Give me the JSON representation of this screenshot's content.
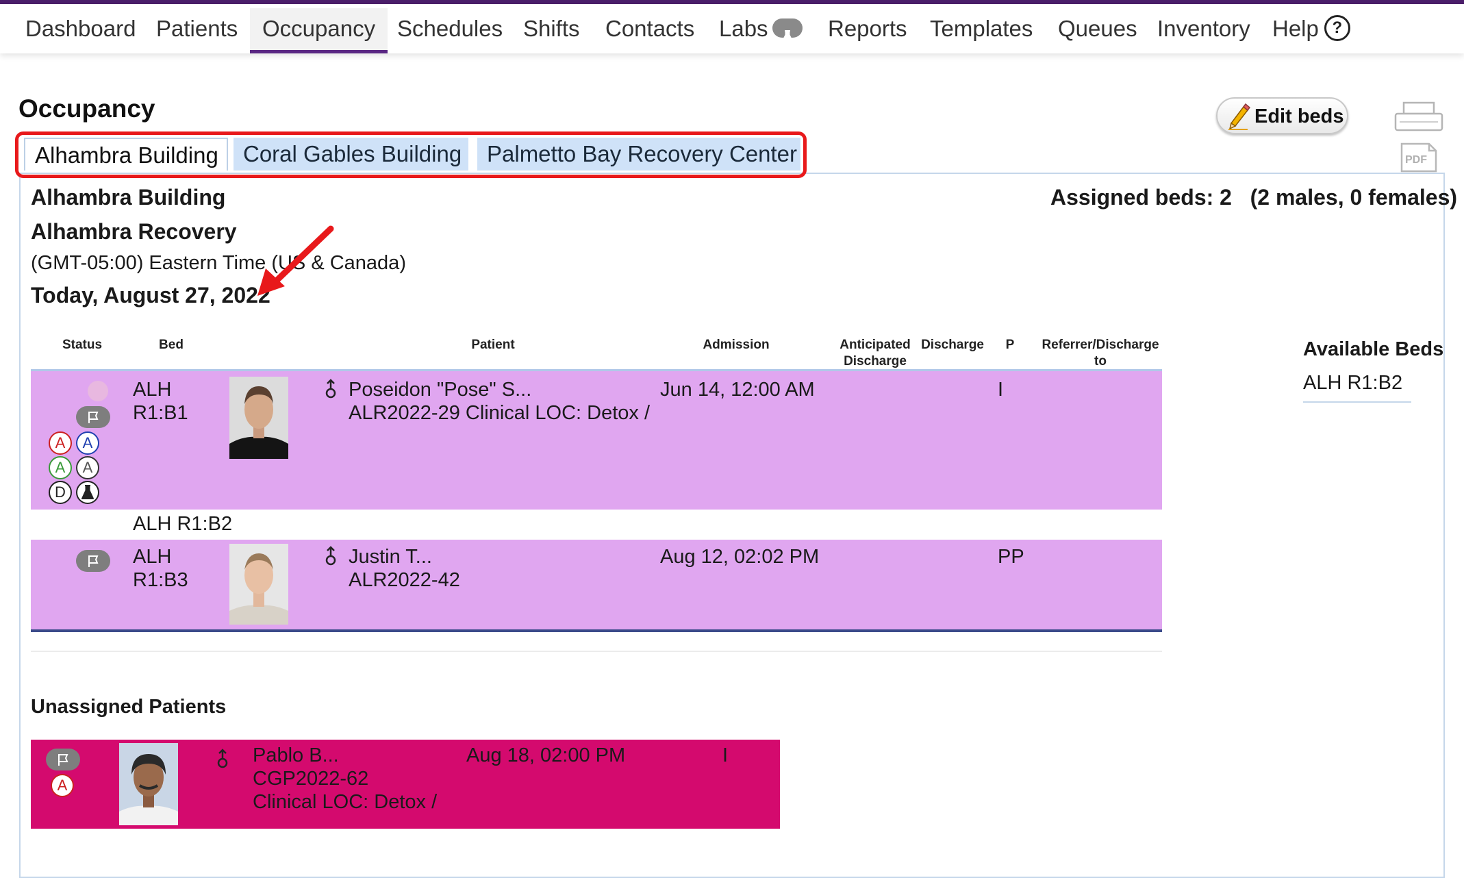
{
  "nav": {
    "items": [
      {
        "label": "Dashboard"
      },
      {
        "label": "Patients"
      },
      {
        "label": "Occupancy"
      },
      {
        "label": "Schedules"
      },
      {
        "label": "Shifts"
      },
      {
        "label": "Contacts"
      },
      {
        "label": "Labs"
      },
      {
        "label": "Reports"
      },
      {
        "label": "Templates"
      },
      {
        "label": "Queues"
      },
      {
        "label": "Inventory"
      },
      {
        "label": "Help"
      }
    ],
    "help_icon_glyph": "?"
  },
  "page": {
    "title": "Occupancy",
    "edit_beds_label": "Edit beds",
    "pdf_label": "PDF"
  },
  "tabs": [
    {
      "label": "Alhambra Building",
      "active": true
    },
    {
      "label": "Coral Gables Building",
      "active": false
    },
    {
      "label": "Palmetto Bay Recovery Center",
      "active": false
    }
  ],
  "building": {
    "name": "Alhambra Building",
    "program": "Alhambra Recovery",
    "timezone": "(GMT-05:00) Eastern Time (US & Canada)",
    "today": "Today, August 27, 2022",
    "assigned_beds": "Assigned beds: 2",
    "gender_breakdown": "(2 males, 0 females)"
  },
  "table": {
    "headers": {
      "status": "Status",
      "bed": "Bed",
      "patient": "Patient",
      "admission": "Admission",
      "anticipated_discharge_1": "Anticipated",
      "anticipated_discharge_2": "Discharge",
      "discharge": "Discharge",
      "p": "P",
      "referrer_1": "Referrer/Discharge",
      "referrer_2": "to"
    },
    "rows": [
      {
        "bed_line1": "ALH",
        "bed_line2": "R1:B1",
        "patient_name": "Poseidon \"Pose\" S...",
        "patient_detail": "ALR2022-29 Clinical LOC: Detox /",
        "admission": "Jun 14, 12:00 AM",
        "p": "I",
        "status_icons": [
          {
            "glyph": "A",
            "color": "#cc2020"
          },
          {
            "glyph": "A",
            "color": "#2040b0"
          },
          {
            "glyph": "A",
            "color": "#3a9a3a"
          },
          {
            "glyph": "A",
            "color": "#555555"
          },
          {
            "glyph": "D",
            "color": "#222222"
          }
        ]
      },
      {
        "bed_empty": "ALH R1:B2"
      },
      {
        "bed_line1": "ALH",
        "bed_line2": "R1:B3",
        "patient_name": "Justin T...",
        "patient_detail": "ALR2022-42",
        "admission": "Aug 12, 02:02 PM",
        "p": "PP"
      }
    ]
  },
  "available_beds": {
    "title": "Available Beds",
    "items": [
      "ALH R1:B2"
    ]
  },
  "unassigned": {
    "title": "Unassigned Patients",
    "rows": [
      {
        "patient_name": "Pablo B...",
        "patient_id": "CGP2022-62",
        "patient_detail": "Clinical LOC: Detox /",
        "admission": "Aug 18, 02:00 PM",
        "p": "I",
        "status_glyph": "A"
      }
    ]
  },
  "colors": {
    "nav_accent": "#5a2783",
    "row_assigned": "#e0a6f0",
    "row_unassigned": "#d40a6e",
    "tab_highlight": "#e8191b",
    "annotation_arrow": "#e8191b"
  },
  "icons": {
    "labs": "flask-icon",
    "help": "question-circle-icon",
    "edit": "pencil-icon",
    "print": "printer-icon",
    "pdf": "pdf-icon",
    "flag": "flag-icon",
    "gender": "male-symbol-icon"
  }
}
